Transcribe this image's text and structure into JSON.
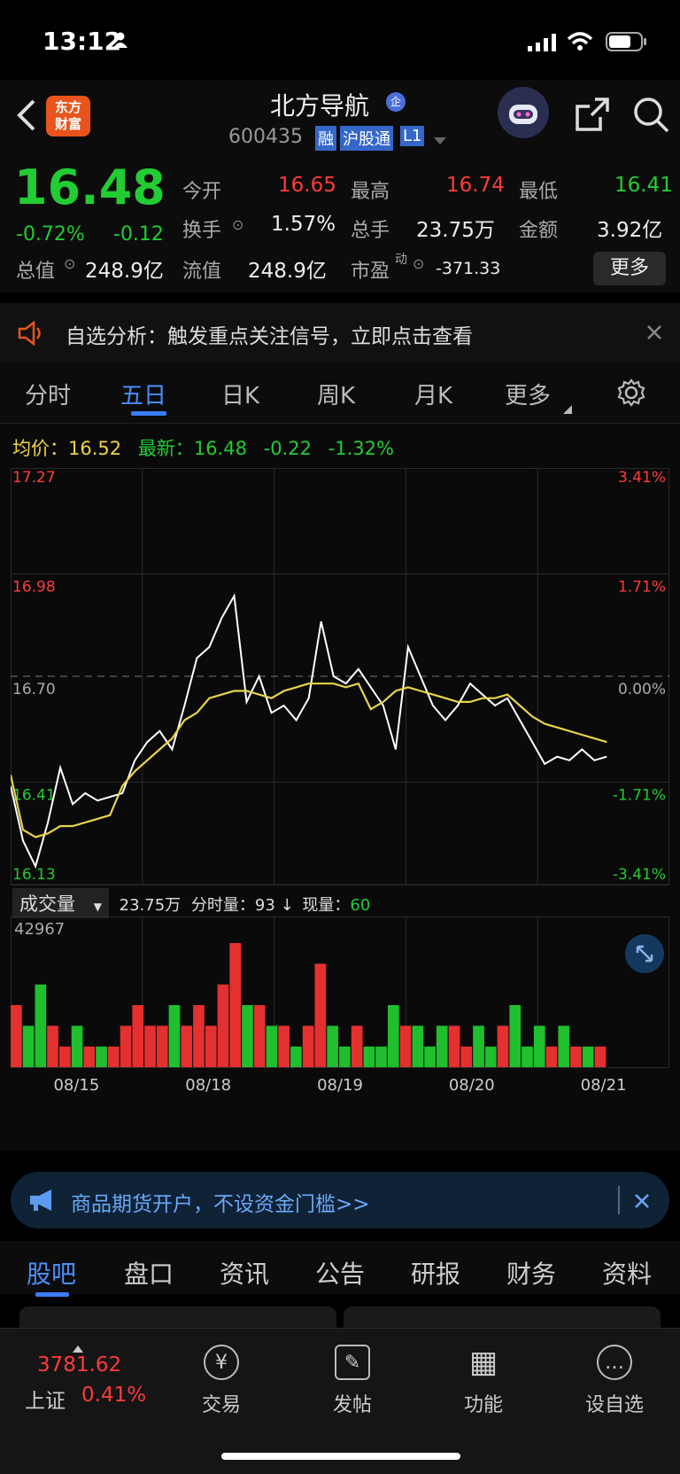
{
  "status_bar": {
    "time": "13:12"
  },
  "header": {
    "app_logo": "东方\n财富",
    "stock_name": "北方导航",
    "stock_code": "600435",
    "badge_rong": "融",
    "badge_hgt": "沪股通",
    "badge_l1": "L1",
    "qi_badge": "企"
  },
  "quote": {
    "price": "16.48",
    "change_pct": "-0.72%",
    "change_abs": "-0.12",
    "open_label": "今开",
    "open": "16.65",
    "high_label": "最高",
    "high": "16.74",
    "low_label": "最低",
    "low": "16.41",
    "turnover_label": "换手",
    "turnover": "1.57%",
    "volume_label": "总手",
    "volume": "23.75万",
    "amount_label": "金额",
    "amount": "3.92亿",
    "mktcap_label": "总值",
    "mktcap": "248.9亿",
    "float_label": "流值",
    "float_cap": "248.9亿",
    "pe_label": "市盈",
    "pe_sup": "动",
    "pe": "-371.33",
    "more_button": "更多"
  },
  "notice": {
    "text": "自选分析：触发重点关注信号，立即点击查看"
  },
  "chart_tabs": {
    "items": [
      "分时",
      "五日",
      "日K",
      "周K",
      "月K",
      "更多"
    ],
    "active": "五日"
  },
  "chart_header": {
    "avg_label": "均价：",
    "avg": "16.52",
    "latest_label": "最新：",
    "latest": "16.48",
    "change": "-0.22",
    "change_pct": "-1.32%"
  },
  "volume_header": {
    "selector": "成交量",
    "total": "23.75万",
    "minute_label": "分时量：",
    "minute": "93",
    "arrow": "↓",
    "current_label": "现量：",
    "current": "60",
    "max": "42967"
  },
  "chart_data": {
    "type": "line",
    "y_ticks_left": [
      "17.27",
      "16.98",
      "16.70",
      "16.41",
      "16.13"
    ],
    "y_ticks_right": [
      "3.41%",
      "1.71%",
      "0.00%",
      "-1.71%",
      "-3.41%"
    ],
    "x_labels": [
      "08/15",
      "08/18",
      "08/19",
      "08/20",
      "08/21"
    ],
    "ylim": [
      16.13,
      17.27
    ],
    "reference": 16.7,
    "series": [
      {
        "values": [
          16.4,
          16.25,
          16.18,
          16.3,
          16.45,
          16.35,
          16.38,
          16.36,
          16.37,
          16.38,
          16.47,
          16.52,
          16.55,
          16.5,
          16.62,
          16.75,
          16.78,
          16.86,
          16.92,
          16.63,
          16.7,
          16.6,
          16.62,
          16.58,
          16.64,
          16.85,
          16.7,
          16.68,
          16.72,
          16.67,
          16.62,
          16.5,
          16.78,
          16.7,
          16.62,
          16.58,
          16.62,
          16.68,
          16.65,
          16.62,
          16.64,
          16.58,
          16.52,
          16.46,
          16.48,
          16.47,
          16.5,
          16.47,
          16.48
        ]
      },
      {
        "values": [
          16.43,
          16.28,
          16.26,
          16.27,
          16.29,
          16.29,
          16.3,
          16.31,
          16.32,
          16.4,
          16.44,
          16.47,
          16.5,
          16.53,
          16.58,
          16.6,
          16.64,
          16.65,
          16.66,
          16.66,
          16.65,
          16.64,
          16.66,
          16.67,
          16.68,
          16.68,
          16.68,
          16.67,
          16.68,
          16.61,
          16.63,
          16.66,
          16.67,
          16.66,
          16.65,
          16.64,
          16.63,
          16.63,
          16.64,
          16.64,
          16.65,
          16.62,
          16.59,
          16.57,
          16.56,
          16.55,
          16.54,
          16.53,
          16.52
        ]
      }
    ],
    "volume": [
      3,
      2,
      4,
      2,
      1,
      2,
      1,
      1,
      1,
      2,
      3,
      2,
      2,
      3,
      2,
      3,
      2,
      4,
      6,
      3,
      3,
      2,
      2,
      1,
      2,
      5,
      2,
      1,
      2,
      1,
      1,
      3,
      2,
      2,
      1,
      2,
      2,
      1,
      2,
      1,
      2,
      3,
      1,
      2,
      1,
      2,
      1,
      1,
      1
    ]
  },
  "ad": {
    "text": "商品期货开户，不设资金门槛>>"
  },
  "sub_tabs": [
    "股吧",
    "盘口",
    "资讯",
    "公告",
    "研报",
    "财务",
    "资料"
  ],
  "bottom_bar": {
    "index_value": "3781.62",
    "index_name": "上证",
    "index_change": "0.41%",
    "buttons": [
      {
        "label": "交易",
        "icon": "¥"
      },
      {
        "label": "发帖",
        "icon": "✎"
      },
      {
        "label": "功能",
        "icon": "▦"
      },
      {
        "label": "设自选",
        "icon": "…"
      }
    ]
  }
}
